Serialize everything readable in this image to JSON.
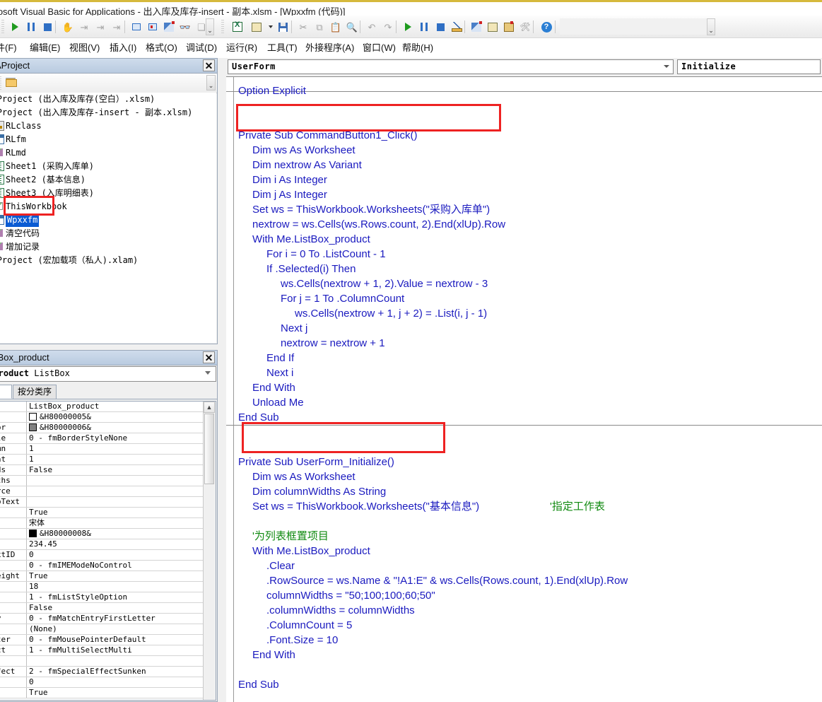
{
  "window": {
    "title": "crosoft Visual Basic for Applications - 出入库及库存-insert - 副本.xlsm - [Wpxxfm (代码)]"
  },
  "toolbar": {
    "items": [
      {
        "name": "run-sub-userform",
        "icon": "play-icon"
      },
      {
        "name": "break",
        "icon": "pause-icon"
      },
      {
        "name": "reset",
        "icon": "stop-icon"
      },
      {
        "name": "design-mode",
        "icon": "hand-icon"
      },
      {
        "name": "project-explorer",
        "icon": "project-explorer-icon"
      },
      {
        "name": "properties-window",
        "icon": "properties-window-icon"
      },
      {
        "name": "object-browser",
        "icon": "object-browser-icon"
      },
      {
        "name": "toolbox",
        "icon": "toolbox-icon"
      },
      {
        "name": "excel-icon",
        "icon": "excel-icon"
      },
      {
        "name": "insert-userform",
        "icon": "insert-userform-icon"
      },
      {
        "name": "save",
        "icon": "save-icon"
      },
      {
        "name": "cut",
        "icon": "scissors-icon"
      },
      {
        "name": "copy",
        "icon": "copy-icon"
      },
      {
        "name": "paste",
        "icon": "paste-icon"
      },
      {
        "name": "find",
        "icon": "binoculars-icon"
      },
      {
        "name": "undo",
        "icon": "undo-icon"
      },
      {
        "name": "redo",
        "icon": "redo-icon"
      },
      {
        "name": "run",
        "icon": "play-icon"
      },
      {
        "name": "break2",
        "icon": "pause-icon"
      },
      {
        "name": "reset2",
        "icon": "stop-icon"
      },
      {
        "name": "design-mode2",
        "icon": "ruler-pencil-icon"
      },
      {
        "name": "wand",
        "icon": "wand-icon"
      },
      {
        "name": "properties",
        "icon": "properties-icon"
      },
      {
        "name": "object-box",
        "icon": "object-box-icon"
      },
      {
        "name": "tools",
        "icon": "tools-icon"
      },
      {
        "name": "help",
        "icon": "help-icon"
      }
    ]
  },
  "menu": {
    "items": [
      {
        "label": "件(F)",
        "key": "F"
      },
      {
        "label": "编辑(E)",
        "key": "E"
      },
      {
        "label": "视图(V)",
        "key": "V"
      },
      {
        "label": "插入(I)",
        "key": "I"
      },
      {
        "label": "格式(O)",
        "key": "O"
      },
      {
        "label": "调试(D)",
        "key": "D"
      },
      {
        "label": "运行(R)",
        "key": "R"
      },
      {
        "label": "工具(T)",
        "key": "T"
      },
      {
        "label": "外接程序(A)",
        "key": "A"
      },
      {
        "label": "窗口(W)",
        "key": "W"
      },
      {
        "label": "帮助(H)",
        "key": "H"
      }
    ]
  },
  "project_explorer": {
    "title": "AProject",
    "close_label": "✕",
    "toolbar": {
      "folder_label": "toggle-folders"
    },
    "nodes": [
      {
        "label": "VBAProject (出入库及库存(空白）.xlsm)",
        "icon": "none",
        "indent": 0,
        "selected": false
      },
      {
        "label": "VBAProject (出入库及库存-insert - 副本.xlsm)",
        "icon": "none",
        "indent": 0,
        "selected": false
      },
      {
        "label": "RLclass",
        "icon": "class-module-icon",
        "indent": 1,
        "selected": false
      },
      {
        "label": "RLfm",
        "icon": "userform-icon",
        "indent": 1,
        "selected": false
      },
      {
        "label": "RLmd",
        "icon": "module-icon",
        "indent": 1,
        "selected": false
      },
      {
        "label": "Sheet1 (采购入库单)",
        "icon": "worksheet-icon",
        "indent": 1,
        "selected": false
      },
      {
        "label": "Sheet2 (基本信息)",
        "icon": "worksheet-icon",
        "indent": 1,
        "selected": false
      },
      {
        "label": "Sheet3 (入库明细表)",
        "icon": "worksheet-icon",
        "indent": 1,
        "selected": false
      },
      {
        "label": "ThisWorkbook",
        "icon": "workbook-icon",
        "indent": 1,
        "selected": false
      },
      {
        "label": "Wpxxfm",
        "icon": "userform-icon",
        "indent": 1,
        "selected": true
      },
      {
        "label": "清空代码",
        "icon": "module-icon",
        "indent": 1,
        "selected": false
      },
      {
        "label": "增加记录",
        "icon": "module-icon",
        "indent": 1,
        "selected": false
      },
      {
        "label": "VBAProject (宏加载项（私人).xlam)",
        "icon": "none",
        "indent": 0,
        "selected": false
      }
    ]
  },
  "properties": {
    "title": "tBox_product",
    "close_label": "✕",
    "object_prefix": "x_product",
    "object_type": "ListBox",
    "tabs": [
      {
        "label": "序",
        "active": true
      },
      {
        "label": "按分类序",
        "active": false
      }
    ],
    "rows": [
      {
        "name": "",
        "value": "ListBox_product",
        "swatch": ""
      },
      {
        "name": "lor",
        "value": "&H80000005&",
        "swatch": "#ffffff"
      },
      {
        "name": "Color",
        "value": "&H80000006&",
        "swatch": "#808080"
      },
      {
        "name": "Style",
        "value": "0 - fmBorderStyleNone",
        "swatch": ""
      },
      {
        "name": "olumn",
        "value": "1",
        "swatch": ""
      },
      {
        "name": "Count",
        "value": "1",
        "swatch": ""
      },
      {
        "name": "Heads",
        "value": "False",
        "swatch": ""
      },
      {
        "name": "Widths",
        "value": "",
        "swatch": ""
      },
      {
        "name": "Source",
        "value": "",
        "swatch": ""
      },
      {
        "name": "lTipText",
        "value": "",
        "swatch": ""
      },
      {
        "name": "d",
        "value": "True",
        "swatch": ""
      },
      {
        "name": "",
        "value": "宋体",
        "swatch": ""
      },
      {
        "name": "lor",
        "value": "&H80000008&",
        "swatch": "#000000"
      },
      {
        "name": "",
        "value": "234.45",
        "swatch": ""
      },
      {
        "name": "ntextID",
        "value": "0",
        "swatch": ""
      },
      {
        "name": "e",
        "value": "0 - fmIMEModeNoControl",
        "swatch": ""
      },
      {
        "name": "alHeight",
        "value": "True",
        "swatch": ""
      },
      {
        "name": "",
        "value": "18",
        "swatch": ""
      },
      {
        "name": "yle",
        "value": "1 - fmListStyleOption",
        "swatch": ""
      },
      {
        "name": "",
        "value": "False",
        "swatch": ""
      },
      {
        "name": "ntry",
        "value": "0 - fmMatchEntryFirstLetter",
        "swatch": ""
      },
      {
        "name": "con",
        "value": "(None)",
        "swatch": ""
      },
      {
        "name": "ointer",
        "value": "0 - fmMousePointerDefault",
        "swatch": ""
      },
      {
        "name": "elect",
        "value": "1 - fmMultiSelectMulti",
        "swatch": ""
      },
      {
        "name": "rce",
        "value": "",
        "swatch": ""
      },
      {
        "name": "lEffect",
        "value": "2 - fmSpecialEffectSunken",
        "swatch": ""
      },
      {
        "name": "ex",
        "value": "0",
        "swatch": ""
      },
      {
        "name": "p",
        "value": "True",
        "swatch": ""
      }
    ]
  },
  "code_window": {
    "object_combo": "UserForm",
    "procedure_combo": "Initialize",
    "lines": [
      {
        "text": "Option Explicit",
        "indent": 0,
        "comment": false
      },
      {
        "text": "",
        "indent": 0,
        "comment": false
      },
      {
        "text": "",
        "indent": 0,
        "comment": false
      },
      {
        "text": "Private Sub CommandButton1_Click()",
        "indent": 0,
        "comment": false
      },
      {
        "text": "Dim ws As Worksheet",
        "indent": 1,
        "comment": false
      },
      {
        "text": "Dim nextrow As Variant",
        "indent": 1,
        "comment": false
      },
      {
        "text": "Dim i As Integer",
        "indent": 1,
        "comment": false
      },
      {
        "text": "Dim j As Integer",
        "indent": 1,
        "comment": false
      },
      {
        "text": "Set ws = ThisWorkbook.Worksheets(\"采购入库单\")",
        "indent": 1,
        "comment": false
      },
      {
        "text": "nextrow = ws.Cells(ws.Rows.count, 2).End(xlUp).Row",
        "indent": 1,
        "comment": false
      },
      {
        "text": "With Me.ListBox_product",
        "indent": 1,
        "comment": false
      },
      {
        "text": "For i = 0 To .ListCount - 1",
        "indent": 2,
        "comment": false
      },
      {
        "text": "If .Selected(i) Then",
        "indent": 2,
        "comment": false
      },
      {
        "text": "ws.Cells(nextrow + 1, 2).Value = nextrow - 3",
        "indent": 3,
        "comment": false
      },
      {
        "text": "For j = 1 To .ColumnCount",
        "indent": 3,
        "comment": false
      },
      {
        "text": "ws.Cells(nextrow + 1, j + 2) = .List(i, j - 1)",
        "indent": 4,
        "comment": false
      },
      {
        "text": "Next j",
        "indent": 3,
        "comment": false
      },
      {
        "text": "nextrow = nextrow + 1",
        "indent": 3,
        "comment": false
      },
      {
        "text": "End If",
        "indent": 2,
        "comment": false
      },
      {
        "text": "Next i",
        "indent": 2,
        "comment": false
      },
      {
        "text": "End With",
        "indent": 1,
        "comment": false
      },
      {
        "text": "Unload Me",
        "indent": 1,
        "comment": false
      },
      {
        "text": "End Sub",
        "indent": 0,
        "comment": false
      },
      {
        "text": "",
        "indent": 0,
        "comment": false
      },
      {
        "text": "",
        "indent": 0,
        "comment": false
      },
      {
        "text": "Private Sub UserForm_Initialize()",
        "indent": 0,
        "comment": false
      },
      {
        "text": "Dim ws As Worksheet",
        "indent": 1,
        "comment": false
      },
      {
        "text": "Dim columnWidths As String",
        "indent": 1,
        "comment": false
      },
      {
        "text": "Set ws = ThisWorkbook.Worksheets(\"基本信息\")",
        "indent": 1,
        "comment": false,
        "trailing_comment": "'指定工作表"
      },
      {
        "text": "",
        "indent": 0,
        "comment": false
      },
      {
        "text": "'为列表框置项目",
        "indent": 1,
        "comment": true
      },
      {
        "text": "With Me.ListBox_product",
        "indent": 1,
        "comment": false
      },
      {
        "text": ".Clear",
        "indent": 2,
        "comment": false
      },
      {
        "text": ".RowSource = ws.Name & \"!A1:E\" & ws.Cells(Rows.count, 1).End(xlUp).Row",
        "indent": 2,
        "comment": false
      },
      {
        "text": "columnWidths = \"50;100;100;60;50\"",
        "indent": 2,
        "comment": false
      },
      {
        "text": ".columnWidths = columnWidths",
        "indent": 2,
        "comment": false
      },
      {
        "text": ".ColumnCount = 5",
        "indent": 2,
        "comment": false
      },
      {
        "text": ".Font.Size = 10",
        "indent": 2,
        "comment": false
      },
      {
        "text": "End With",
        "indent": 1,
        "comment": false
      },
      {
        "text": "",
        "indent": 0,
        "comment": false
      },
      {
        "text": "End Sub",
        "indent": 0,
        "comment": false
      }
    ]
  },
  "annotations": {
    "color": "#ee2222",
    "boxes": [
      {
        "name": "highlight-commandbutton1-click"
      },
      {
        "name": "highlight-userform-initialize"
      },
      {
        "name": "highlight-wpxxfm-node"
      }
    ]
  }
}
